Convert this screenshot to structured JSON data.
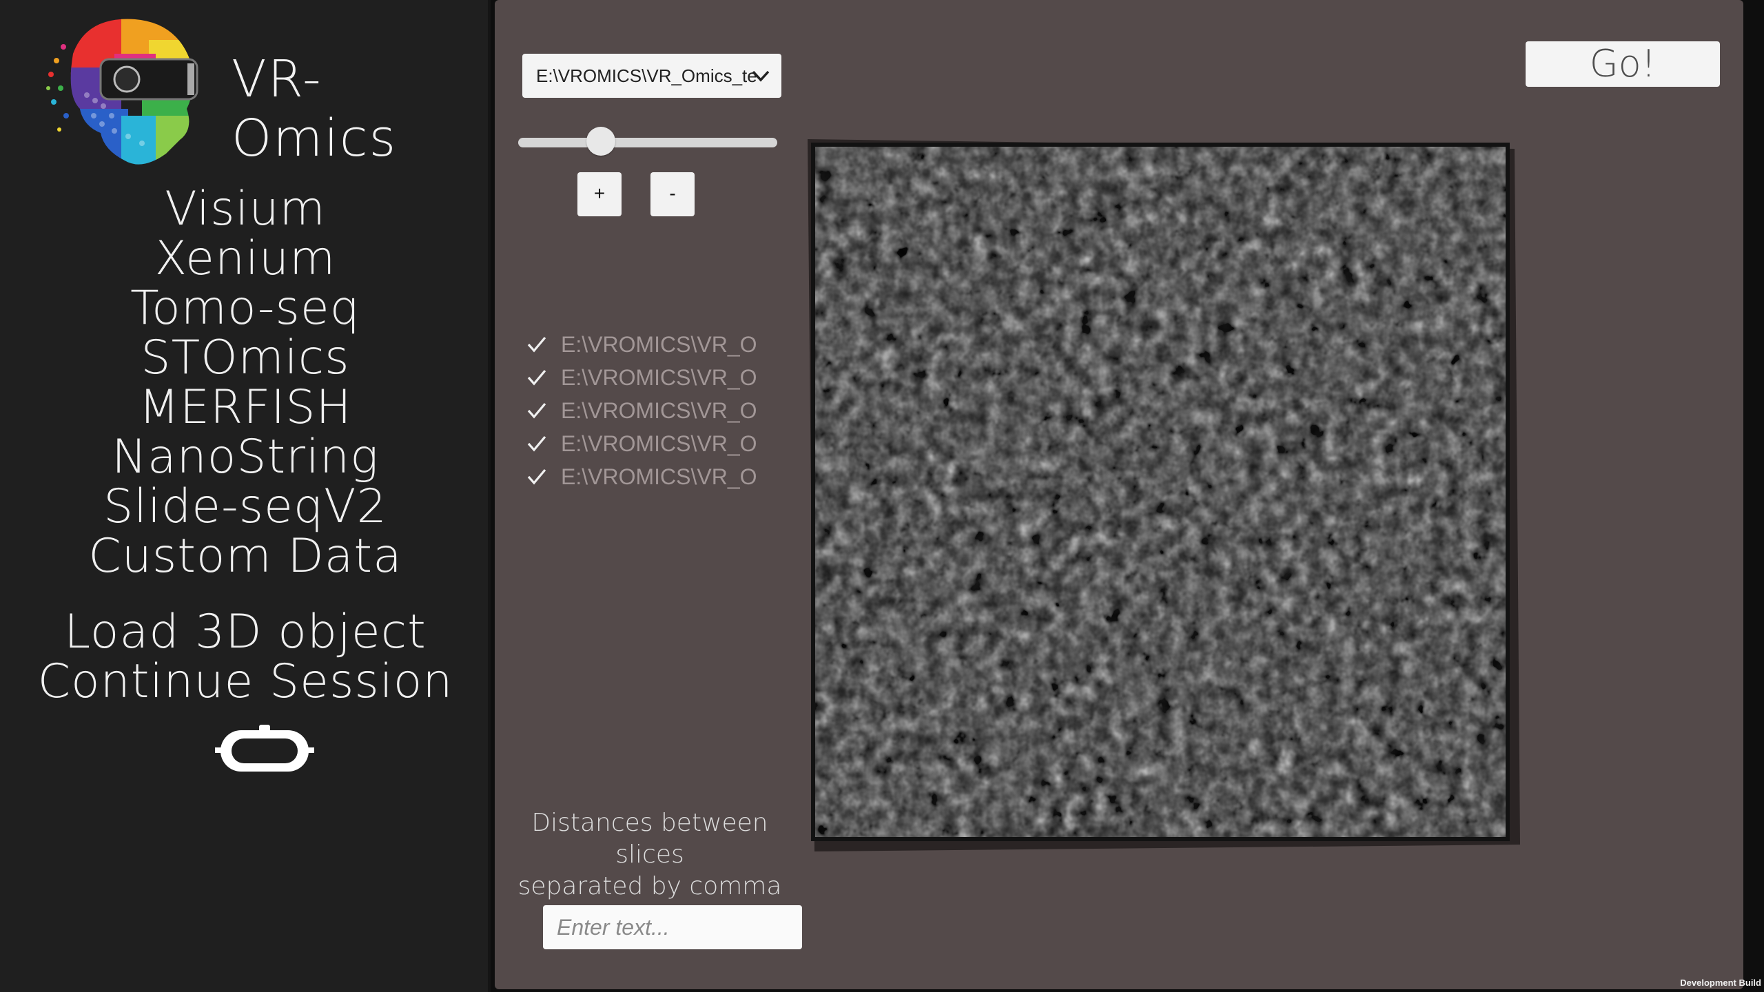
{
  "app": {
    "title": "VR-Omics"
  },
  "sidebar": {
    "datasets": [
      {
        "label": "Visium"
      },
      {
        "label": "Xenium"
      },
      {
        "label": "Tomo-seq"
      },
      {
        "label": "STOmics"
      },
      {
        "label": "MERFISH"
      },
      {
        "label": "NanoString"
      },
      {
        "label": "Slide-seqV2"
      },
      {
        "label": "Custom Data"
      }
    ],
    "actions": [
      {
        "label": "Load 3D object"
      },
      {
        "label": "Continue Session"
      }
    ],
    "vr_icon": "vr-headset-icon"
  },
  "main": {
    "path_dropdown": {
      "value": "E:\\VROMICS\\VR_Omics_te",
      "icon": "chevron-down-icon"
    },
    "slider": {
      "value": 0.32
    },
    "plus_label": "+",
    "minus_label": "-",
    "files": [
      {
        "label": "E:\\VROMICS\\VR_O",
        "checked": true
      },
      {
        "label": "E:\\VROMICS\\VR_O",
        "checked": true
      },
      {
        "label": "E:\\VROMICS\\VR_O",
        "checked": true
      },
      {
        "label": "E:\\VROMICS\\VR_O",
        "checked": true
      },
      {
        "label": "E:\\VROMICS\\VR_O",
        "checked": true
      }
    ],
    "go_label": "Go!",
    "distances": {
      "label_line1": "Distances between slices",
      "label_line2": "separated by comma",
      "placeholder": "Enter text...",
      "value": ""
    }
  },
  "footer": {
    "build_label": "Development Build"
  },
  "colors": {
    "sidebar_bg": "#1f1f1f",
    "main_bg": "#544a4a",
    "text_light": "#f0f0f0",
    "file_text": "#a29797"
  }
}
